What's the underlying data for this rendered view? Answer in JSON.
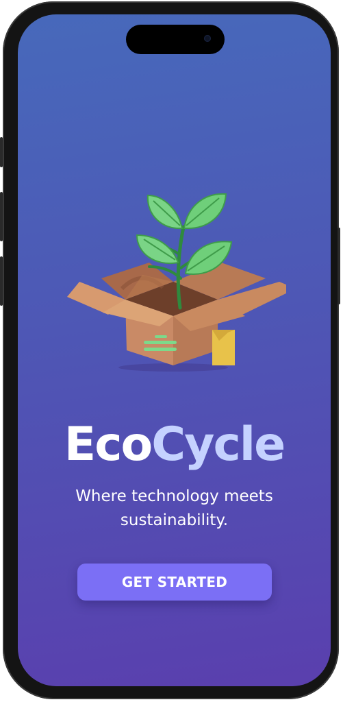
{
  "app": {
    "name_part1": "Eco",
    "name_part2": "Cycle"
  },
  "hero": {
    "icon": "plant-in-box-illustration"
  },
  "tagline": {
    "line1": "Where technology meets",
    "line2": "sustainability."
  },
  "cta": {
    "label": "GET STARTED"
  },
  "colors": {
    "background_top": "#4769bb",
    "background_bottom": "#5a3fae",
    "accent_button": "#7b6ff5",
    "title_primary": "#ffffff",
    "title_secondary": "#c5d2ff"
  }
}
